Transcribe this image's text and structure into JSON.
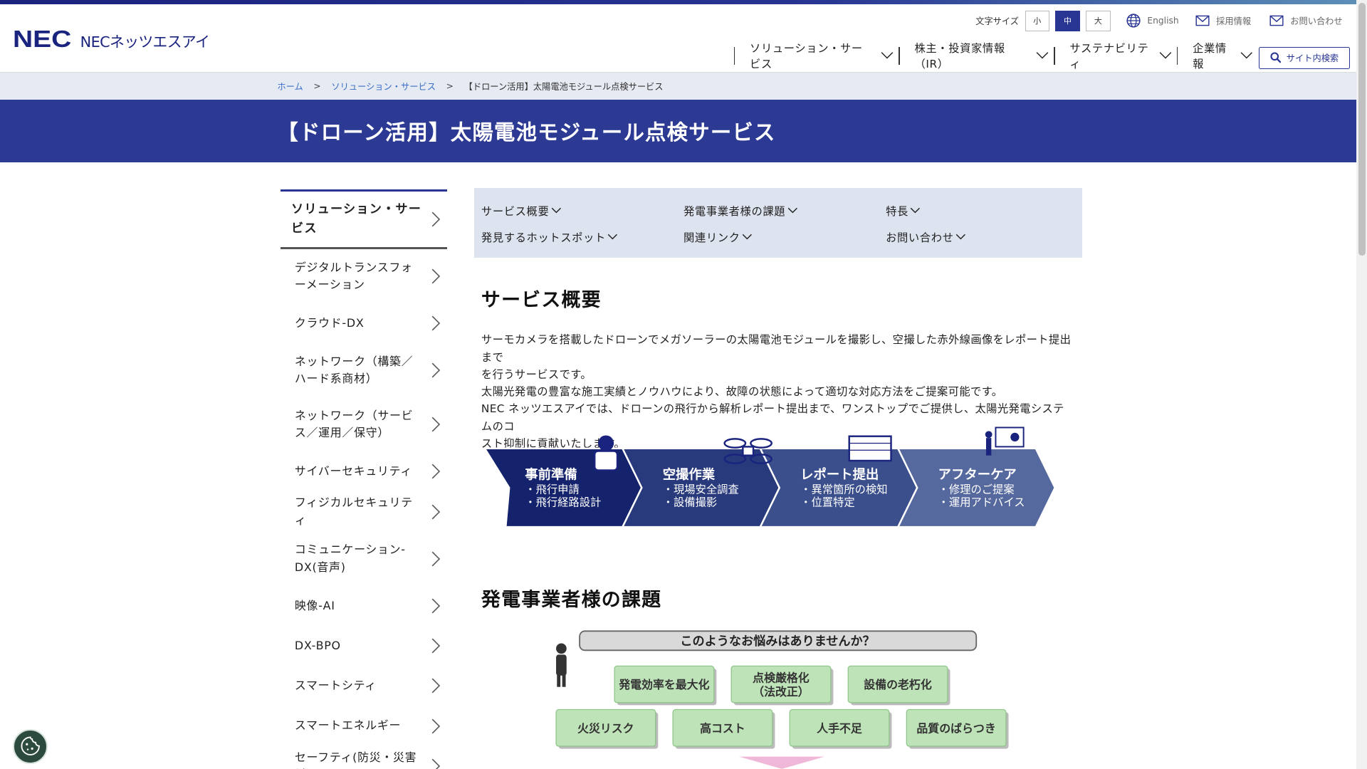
{
  "header": {
    "logo_mark": "NEC",
    "logo_text": "NECネッツエスアイ",
    "font_size_label": "文字サイズ",
    "font_sizes": [
      "小",
      "中",
      "大"
    ],
    "english": "English",
    "recruit": "採用情報",
    "contact": "お問い合わせ",
    "search": "サイト内検索",
    "nav": [
      "ソリューション・サービス",
      "株主・投資家情報（IR）",
      "サステナビリティ",
      "企業情報"
    ]
  },
  "breadcrumb": {
    "home": "ホーム",
    "solutions": "ソリューション・サービス",
    "current": "【ドローン活用】太陽電池モジュール点検サービス"
  },
  "page_title": "【ドローン活用】太陽電池モジュール点検サービス",
  "sidebar": {
    "title": "ソリューション・サービス",
    "items": [
      "デジタルトランスフォーメーション",
      "クラウド-DX",
      "ネットワーク（構築／ハード系商材）",
      "ネットワーク（サービス／運用／保守）",
      "サイバーセキュリティ",
      "フィジカルセキュリティ",
      "コミュニケーション-DX(音声)",
      "映像-AI",
      "DX-BPO",
      "スマートシティ",
      "スマートエネルギー",
      "セーフティ(防災・災害対"
    ]
  },
  "anchors": [
    "サービス概要",
    "発電事業者様の課題",
    "特長",
    "発見するホットスポット",
    "関連リンク",
    "お問い合わせ"
  ],
  "overview": {
    "heading": "サービス概要",
    "lines": [
      "サーモカメラを搭載したドローンでメガソーラーの太陽電池モジュールを撮影し、空撮した赤外線画像をレポート提出まで",
      "を行うサービスです。",
      "太陽光発電の豊富な施工実績とノウハウにより、故障の状態によって適切な対応方法をご提案可能です。",
      "NEC ネッツエスアイでは、ドローンの飛行から解析レポート提出まで、ワンストップでご提供し、太陽光発電システムのコ",
      "スト抑制に貢献いたします。"
    ]
  },
  "flow": [
    {
      "title": "事前準備",
      "points": [
        "・飛行申請",
        "・飛行経路設計"
      ],
      "color": "#14236b"
    },
    {
      "title": "空撮作業",
      "points": [
        "・現場安全調査",
        "・設備撮影"
      ],
      "color": "#283a7c"
    },
    {
      "title": "レポート提出",
      "points": [
        "・異常箇所の検知",
        "・位置特定"
      ],
      "color": "#3b4f8c"
    },
    {
      "title": "アフターケア",
      "points": [
        "・修理のご提案",
        "・運用アドバイス"
      ],
      "color": "#56699e"
    }
  ],
  "issues": {
    "heading": "発電事業者様の課題",
    "question": "このようなお悩みはありませんか？",
    "row1": [
      "発電効率を最大化",
      "点検厳格化\n（法改正）",
      "設備の老朽化"
    ],
    "row2": [
      "火災リスク",
      "高コスト",
      "人手不足",
      "品質のばらつき"
    ]
  }
}
